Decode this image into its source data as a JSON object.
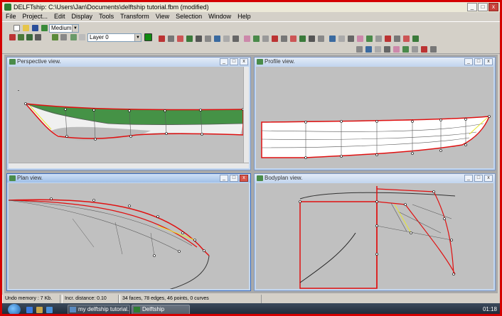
{
  "window": {
    "title": "DELFTship: C:\\Users\\Jan\\Documents\\delftship tutorial.fbm (modified)",
    "controls": [
      "_",
      "□",
      "x"
    ]
  },
  "menu": [
    "File",
    "Project...",
    "Edit",
    "Display",
    "Tools",
    "Transform",
    "View",
    "Selection",
    "Window",
    "Help"
  ],
  "toolbar": {
    "precision_value": "Medium",
    "layer_value": "Layer 0",
    "layer_color": "#118a11"
  },
  "panes": {
    "perspective": "Perspective view.",
    "profile": "Profile view.",
    "plan": "Plan view.",
    "bodyplan": "Bodyplan view."
  },
  "status": {
    "memory": "Undo memory : 7 Kb.",
    "increment": "Incr. distance: 0.10",
    "model_info": "34 faces, 78 edges, 46 points, 0 curves"
  },
  "taskbar": {
    "items": [
      "my delftship tutorial...",
      "Delftship"
    ],
    "clock": "01:18"
  },
  "colors": {
    "hull_edge": "#e01010",
    "hull_fill": "#3f8f3a",
    "control_net": "#5a5a5a",
    "highlight": "#e8e830",
    "frame": "#d40000"
  }
}
